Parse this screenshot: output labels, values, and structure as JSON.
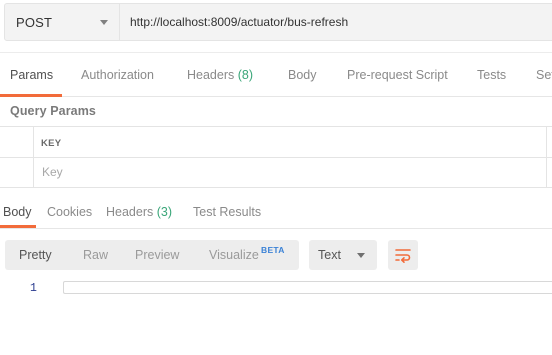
{
  "request": {
    "method": "POST",
    "url": "http://localhost:8009/actuator/bus-refresh"
  },
  "request_tabs": [
    {
      "label": "Params",
      "active": true
    },
    {
      "label": "Authorization",
      "active": false
    },
    {
      "label": "Headers",
      "count": "(8)",
      "active": false
    },
    {
      "label": "Body",
      "active": false
    },
    {
      "label": "Pre-request Script",
      "active": false
    },
    {
      "label": "Tests",
      "active": false
    },
    {
      "label": "Set",
      "active": false
    }
  ],
  "query_params": {
    "title": "Query Params",
    "column_key": "KEY",
    "key_placeholder": "Key"
  },
  "response_tabs": [
    {
      "label": "Body",
      "active": true
    },
    {
      "label": "Cookies",
      "active": false
    },
    {
      "label": "Headers",
      "count": "(3)",
      "active": false
    },
    {
      "label": "Test Results",
      "active": false
    }
  ],
  "response_view": {
    "modes": [
      {
        "label": "Pretty",
        "active": true
      },
      {
        "label": "Raw",
        "active": false
      },
      {
        "label": "Preview",
        "active": false
      },
      {
        "label": "Visualize",
        "active": false
      }
    ],
    "beta_badge": "BETA",
    "format": "Text",
    "wrap_icon": "wrap-lines-icon"
  },
  "editor": {
    "line_numbers": [
      "1"
    ]
  },
  "colors": {
    "accent": "#f26b3a",
    "count_green": "#3aa679",
    "beta_blue": "#3b82d6",
    "line_number": "#2a3b8f"
  }
}
